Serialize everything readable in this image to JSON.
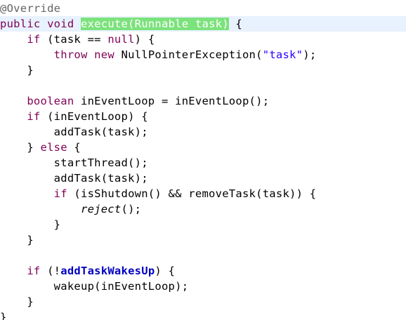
{
  "editor": {
    "lines": [
      {
        "tokens": [
          {
            "text": "@Override",
            "type": "annotation"
          }
        ]
      },
      {
        "current": true,
        "tokens": [
          {
            "text": "public",
            "type": "keyword"
          },
          {
            "text": " ",
            "type": "plain"
          },
          {
            "text": "void",
            "type": "keyword"
          },
          {
            "text": " ",
            "type": "plain"
          },
          {
            "text": "execute(Runnable task)",
            "type": "highlight"
          },
          {
            "text": " {",
            "type": "plain"
          }
        ]
      },
      {
        "tokens": [
          {
            "text": "    ",
            "type": "plain"
          },
          {
            "text": "if",
            "type": "keyword"
          },
          {
            "text": " (task == ",
            "type": "plain"
          },
          {
            "text": "null",
            "type": "keyword"
          },
          {
            "text": ") {",
            "type": "plain"
          }
        ]
      },
      {
        "tokens": [
          {
            "text": "        ",
            "type": "plain"
          },
          {
            "text": "throw",
            "type": "keyword"
          },
          {
            "text": " ",
            "type": "plain"
          },
          {
            "text": "new",
            "type": "keyword"
          },
          {
            "text": " NullPointerException(",
            "type": "plain"
          },
          {
            "text": "\"task\"",
            "type": "string"
          },
          {
            "text": ");",
            "type": "plain"
          }
        ]
      },
      {
        "tokens": [
          {
            "text": "    }",
            "type": "plain"
          }
        ]
      },
      {
        "tokens": []
      },
      {
        "tokens": [
          {
            "text": "    ",
            "type": "plain"
          },
          {
            "text": "boolean",
            "type": "keyword"
          },
          {
            "text": " inEventLoop = inEventLoop();",
            "type": "plain"
          }
        ]
      },
      {
        "tokens": [
          {
            "text": "    ",
            "type": "plain"
          },
          {
            "text": "if",
            "type": "keyword"
          },
          {
            "text": " (inEventLoop) {",
            "type": "plain"
          }
        ]
      },
      {
        "tokens": [
          {
            "text": "        addTask(task);",
            "type": "plain"
          }
        ]
      },
      {
        "tokens": [
          {
            "text": "    } ",
            "type": "plain"
          },
          {
            "text": "else",
            "type": "keyword"
          },
          {
            "text": " {",
            "type": "plain"
          }
        ]
      },
      {
        "tokens": [
          {
            "text": "        startThread();",
            "type": "plain"
          }
        ]
      },
      {
        "tokens": [
          {
            "text": "        addTask(task);",
            "type": "plain"
          }
        ]
      },
      {
        "tokens": [
          {
            "text": "        ",
            "type": "plain"
          },
          {
            "text": "if",
            "type": "keyword"
          },
          {
            "text": " (isShutdown() && removeTask(task)) {",
            "type": "plain"
          }
        ]
      },
      {
        "tokens": [
          {
            "text": "            ",
            "type": "plain"
          },
          {
            "text": "reject",
            "type": "italic"
          },
          {
            "text": "();",
            "type": "plain"
          }
        ]
      },
      {
        "tokens": [
          {
            "text": "        }",
            "type": "plain"
          }
        ]
      },
      {
        "tokens": [
          {
            "text": "    }",
            "type": "plain"
          }
        ]
      },
      {
        "tokens": []
      },
      {
        "tokens": [
          {
            "text": "    ",
            "type": "plain"
          },
          {
            "text": "if",
            "type": "keyword"
          },
          {
            "text": " (!",
            "type": "plain"
          },
          {
            "text": "addTaskWakesUp",
            "type": "field"
          },
          {
            "text": ") {",
            "type": "plain"
          }
        ]
      },
      {
        "tokens": [
          {
            "text": "        wakeup(inEventLoop);",
            "type": "plain"
          }
        ]
      },
      {
        "tokens": [
          {
            "text": "    }",
            "type": "plain"
          }
        ]
      },
      {
        "tokens": [
          {
            "text": "}",
            "type": "plain"
          }
        ]
      }
    ]
  }
}
